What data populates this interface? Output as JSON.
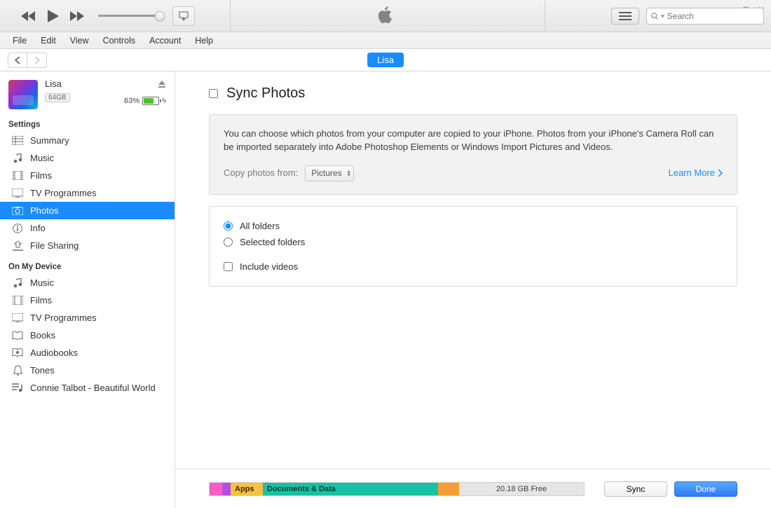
{
  "search_placeholder": "Search",
  "menu": [
    "File",
    "Edit",
    "View",
    "Controls",
    "Account",
    "Help"
  ],
  "device_pill": "Lisa",
  "device": {
    "name": "Lisa",
    "capacity": "64GB",
    "battery_percent": "63%",
    "battery_fill_pct": 63
  },
  "sidebar": {
    "settings_header": "Settings",
    "on_device_header": "On My Device",
    "settings": [
      {
        "id": "summary",
        "label": "Summary"
      },
      {
        "id": "music",
        "label": "Music"
      },
      {
        "id": "films",
        "label": "Films"
      },
      {
        "id": "tv",
        "label": "TV Programmes"
      },
      {
        "id": "photos",
        "label": "Photos",
        "selected": true
      },
      {
        "id": "info",
        "label": "Info"
      },
      {
        "id": "file-sharing",
        "label": "File Sharing"
      }
    ],
    "ondevice": [
      {
        "id": "d-music",
        "label": "Music"
      },
      {
        "id": "d-films",
        "label": "Films"
      },
      {
        "id": "d-tv",
        "label": "TV Programmes"
      },
      {
        "id": "d-books",
        "label": "Books"
      },
      {
        "id": "d-audiobooks",
        "label": "Audiobooks"
      },
      {
        "id": "d-tones",
        "label": "Tones"
      },
      {
        "id": "d-playlist",
        "label": "Connie Talbot - Beautiful World"
      }
    ]
  },
  "content": {
    "title": "Sync Photos",
    "info_text": "You can choose which photos from your computer are copied to your iPhone. Photos from your iPhone's Camera Roll can be imported separately into Adobe Photoshop Elements or Windows Import Pictures and Videos.",
    "copy_from_label": "Copy photos from:",
    "dropdown_value": "Pictures",
    "learn_more": "Learn More",
    "opt_all": "All folders",
    "opt_selected": "Selected folders",
    "opt_include_videos": "Include videos"
  },
  "footer": {
    "apps_label": "Apps",
    "docs_label": "Documents & Data",
    "free_label": "20.18 GB Free",
    "sync_label": "Sync",
    "done_label": "Done"
  }
}
